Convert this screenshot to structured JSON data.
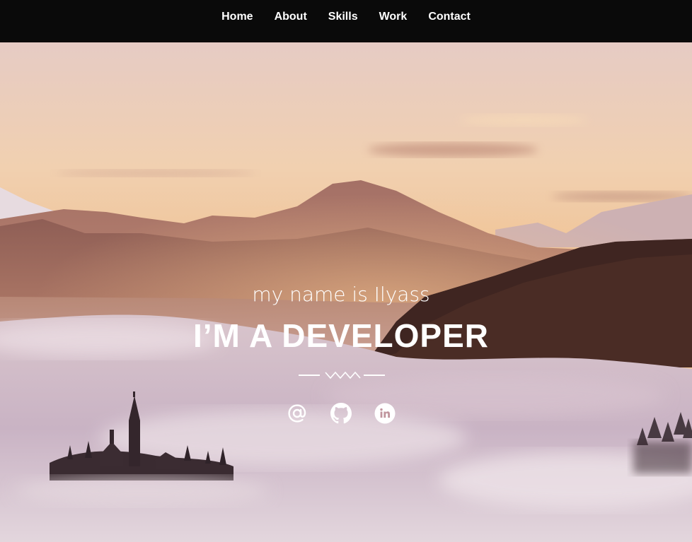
{
  "nav": {
    "items": [
      {
        "label": "Home"
      },
      {
        "label": "About"
      },
      {
        "label": "Skills"
      },
      {
        "label": "Work"
      },
      {
        "label": "Contact"
      }
    ]
  },
  "hero": {
    "intro": "my name is Ilyass",
    "headline": "I’M A DEVELOPER"
  },
  "socials": [
    {
      "icon": "at-icon"
    },
    {
      "icon": "github-icon"
    },
    {
      "icon": "linkedin-icon"
    }
  ],
  "colors": {
    "nav_bg": "#0a0a0a",
    "text": "#ffffff"
  }
}
